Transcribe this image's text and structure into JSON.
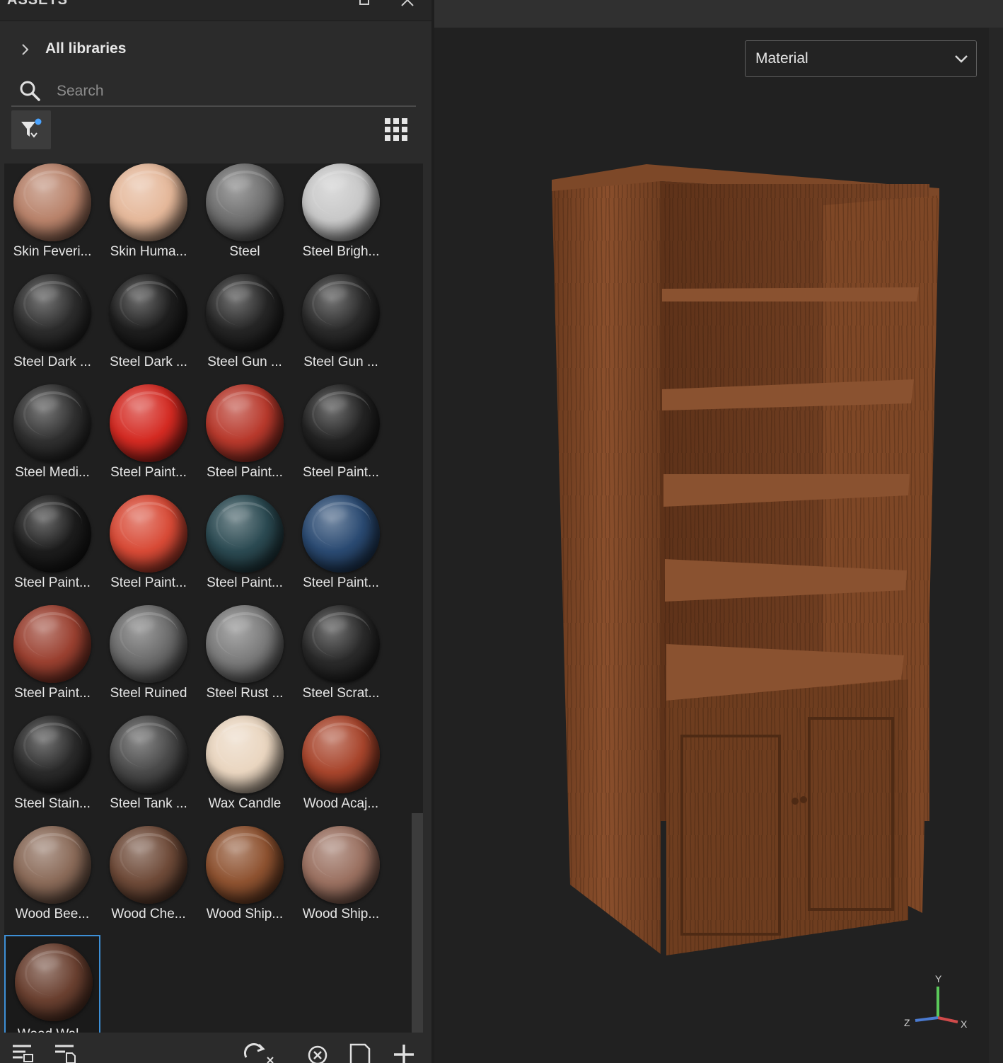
{
  "assets_panel": {
    "title": "ASSETS",
    "all_libraries_label": "All libraries",
    "search": {
      "placeholder": "Search",
      "value": ""
    }
  },
  "materials": [
    {
      "label": "Skin Feveri...",
      "color": "#b8826a",
      "selected": false
    },
    {
      "label": "Skin Huma...",
      "color": "#e5b89a",
      "selected": false
    },
    {
      "label": "Steel",
      "color": "#6e6e6e",
      "selected": false
    },
    {
      "label": "Steel Brigh...",
      "color": "#c8c8c8",
      "selected": false
    },
    {
      "label": "Steel Dark ...",
      "color": "#2c2c2c",
      "selected": false
    },
    {
      "label": "Steel Dark ...",
      "color": "#1e1e1e",
      "selected": false
    },
    {
      "label": "Steel Gun ...",
      "color": "#252525",
      "selected": false
    },
    {
      "label": "Steel Gun ...",
      "color": "#2a2a2a",
      "selected": false
    },
    {
      "label": "Steel Medi...",
      "color": "#303030",
      "selected": false
    },
    {
      "label": "Steel Paint...",
      "color": "#d42a22",
      "selected": false
    },
    {
      "label": "Steel Paint...",
      "color": "#b8392c",
      "selected": false
    },
    {
      "label": "Steel Paint...",
      "color": "#232323",
      "selected": false
    },
    {
      "label": "Steel Paint...",
      "color": "#1c1c1c",
      "selected": false
    },
    {
      "label": "Steel Paint...",
      "color": "#d84a36",
      "selected": false
    },
    {
      "label": "Steel Paint...",
      "color": "#2b4a52",
      "selected": false
    },
    {
      "label": "Steel Paint...",
      "color": "#2a4a72",
      "selected": false
    },
    {
      "label": "Steel Paint...",
      "color": "#9a4030",
      "selected": false
    },
    {
      "label": "Steel Ruined",
      "color": "#6a6a6a",
      "selected": false
    },
    {
      "label": "Steel Rust ...",
      "color": "#7a7a7a",
      "selected": false
    },
    {
      "label": "Steel Scrat...",
      "color": "#2a2a2a",
      "selected": false
    },
    {
      "label": "Steel Stain...",
      "color": "#2a2a2a",
      "selected": false
    },
    {
      "label": "Steel Tank ...",
      "color": "#4a4a4a",
      "selected": false
    },
    {
      "label": "Wax Candle",
      "color": "#ead6c0",
      "selected": false
    },
    {
      "label": "Wood Acaj...",
      "color": "#a8452c",
      "selected": false
    },
    {
      "label": "Wood Bee...",
      "color": "#8a6a58",
      "selected": false
    },
    {
      "label": "Wood Che...",
      "color": "#6e4a38",
      "selected": false
    },
    {
      "label": "Wood Ship...",
      "color": "#8e5230",
      "selected": false
    },
    {
      "label": "Wood Ship...",
      "color": "#9a7060",
      "selected": false
    },
    {
      "label": "Wood Wal...",
      "color": "#6a4030",
      "selected": true
    }
  ],
  "viewport": {
    "material_dropdown": {
      "selected": "Material"
    },
    "axes": {
      "x": "X",
      "y": "Y",
      "z": "Z"
    }
  },
  "colors": {
    "selection_accent": "#3d8fd6",
    "filter_dot": "#4aa3ff",
    "wood": "#7a4526",
    "axis_x": "#d04a4a",
    "axis_y": "#5ac85a",
    "axis_z": "#4a7ad0"
  }
}
